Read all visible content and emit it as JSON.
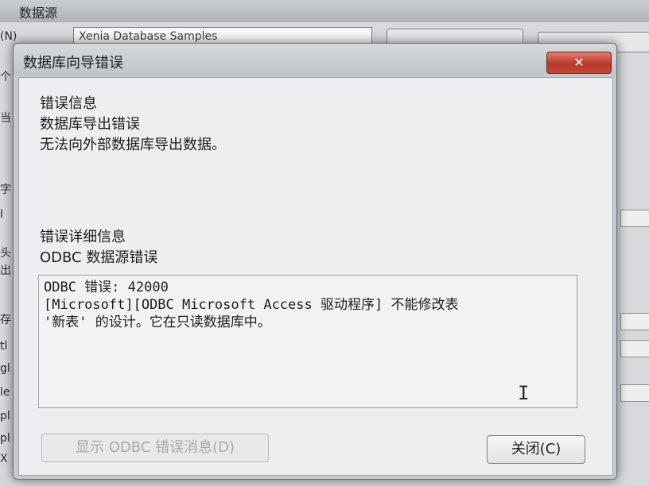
{
  "background_window": {
    "title": "数据源",
    "field_value": "Xenia Database Samples",
    "left_labels": [
      "(N)",
      "个",
      "当",
      "字",
      "I",
      "头",
      "出",
      "存",
      "tl",
      "gl",
      "le",
      "pl",
      "pl",
      "X"
    ]
  },
  "dialog": {
    "title": "数据库向导错误",
    "close_glyph": "✕",
    "error_info": {
      "heading": "错误信息",
      "line1": "数据库导出错误",
      "line2": "无法向外部数据库导出数据。"
    },
    "error_details": {
      "heading": "错误详细信息",
      "subheading": "ODBC 数据源错误"
    },
    "details_box": {
      "line1": "ODBC 错误: 42000",
      "line2": "[Microsoft][ODBC Microsoft Access 驱动程序] 不能修改表",
      "line3": "'新表' 的设计。它在只读数据库中。"
    },
    "buttons": {
      "show_odbc": "显示 ODBC 错误消息(D)",
      "close": "关闭(C)"
    }
  },
  "colors": {
    "close_button_red": "#c44534",
    "dialog_body": "#eceeef"
  }
}
